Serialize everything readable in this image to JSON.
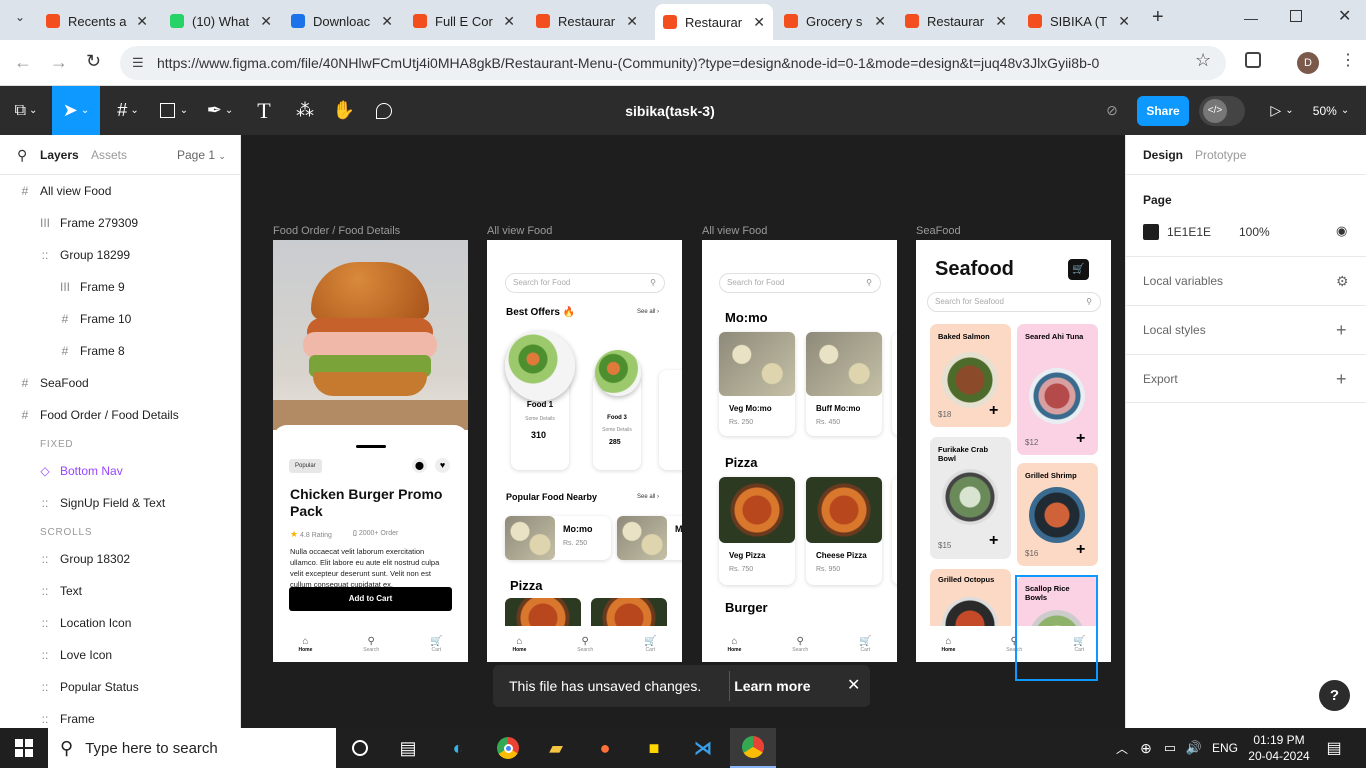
{
  "browser": {
    "tabs": [
      {
        "title": "Recents a",
        "color": "#f24e1e"
      },
      {
        "title": "(10) What",
        "color": "#25d366"
      },
      {
        "title": "Downloac",
        "color": "#1a73e8"
      },
      {
        "title": "Full E Cor",
        "color": "#f24e1e"
      },
      {
        "title": "Restaurar",
        "color": "#f24e1e"
      },
      {
        "title": "Restaurar",
        "color": "#f24e1e"
      },
      {
        "title": "Grocery s",
        "color": "#f24e1e"
      },
      {
        "title": "Restaurar",
        "color": "#f24e1e"
      },
      {
        "title": "SIBIKA (T",
        "color": "#f24e1e"
      }
    ],
    "active_tab": 5,
    "close_glyph": "✕",
    "new_tab_glyph": "+",
    "url": "https://www.figma.com/file/40NHlwFCmUtj4i0MHA8gkB/Restaurant-Menu-(Community)?type=design&node-id=0-1&mode=design&t=juq48v3JlxGyii8b-0",
    "profile_initial": "D"
  },
  "figma": {
    "file_title": "sibika(task-3)",
    "share_label": "Share",
    "zoom": "50%",
    "layers_tab": "Layers",
    "assets_tab": "Assets",
    "page_selector": "Page 1",
    "layers": [
      {
        "name": "All view Food",
        "indent": 0,
        "icon": "#"
      },
      {
        "name": "Frame 279309",
        "indent": 1,
        "icon": "III"
      },
      {
        "name": "Group 18299",
        "indent": 1,
        "icon": "::"
      },
      {
        "name": "Frame 9",
        "indent": 2,
        "icon": "III"
      },
      {
        "name": "Frame 10",
        "indent": 2,
        "icon": "#"
      },
      {
        "name": "Frame 8",
        "indent": 2,
        "icon": "#"
      },
      {
        "name": "SeaFood",
        "indent": 0,
        "icon": "#"
      },
      {
        "name": "Food Order / Food Details",
        "indent": 0,
        "icon": "#"
      }
    ],
    "section_fixed": "FIXED",
    "fixed_layers": [
      {
        "name": "Bottom Nav",
        "icon": "◇",
        "component": true
      },
      {
        "name": "SignUp Field & Text",
        "icon": "::",
        "component": false
      }
    ],
    "section_scrolls": "SCROLLS",
    "scroll_layers": [
      "Group 18302",
      "Text",
      "Location Icon",
      "Love Icon",
      "Popular Status",
      "Frame"
    ],
    "design_tab": "Design",
    "prototype_tab": "Prototype",
    "page_heading": "Page",
    "page_color": "1E1E1E",
    "page_opacity": "100%",
    "local_variables": "Local variables",
    "local_styles": "Local styles",
    "export": "Export",
    "toast_text": "This file has unsaved changes.",
    "toast_link": "Learn more",
    "help": "?"
  },
  "frames": {
    "f1": {
      "label": "Food Order / Food Details",
      "badge": "Popular",
      "title": "Chicken Burger Promo Pack",
      "rating": "4.8 Rating",
      "orders": "2000+ Order",
      "desc": "Nulla occaecat velit laborum exercitation ullamco. Elit labore eu aute elit nostrud culpa velit excepteur deserunt sunt. Velit non est cullum consequat cupidatat ex.",
      "cta": "Add to Cart"
    },
    "f2": {
      "label": "All view Food",
      "search": "Search for Food",
      "best_offers": "Best Offers",
      "see_all": "See all",
      "food1": "Food 1",
      "food1_details": "Some Details",
      "food1_price": "310",
      "food3": "Food 3",
      "food3_details": "Some Details",
      "food3_price": "285",
      "popular": "Popular Food Nearby",
      "momo": "Mo:mo",
      "momo_price": "Rs. 250",
      "pizza": "Pizza"
    },
    "f3": {
      "label": "All view Food",
      "search": "Search for Food",
      "momo": "Mo:mo",
      "veg_momo": "Veg Mo:mo",
      "veg_momo_price": "Rs. 250",
      "buff_momo": "Buff Mo:mo",
      "buff_momo_price": "Rs. 450",
      "pizza": "Pizza",
      "veg_pizza": "Veg Pizza",
      "veg_pizza_price": "Rs. 750",
      "cheese_pizza": "Cheese Pizza",
      "cheese_pizza_price": "Rs. 950",
      "burger": "Burger"
    },
    "f4": {
      "label": "SeaFood",
      "title": "Seafood",
      "search": "Search for Seafood",
      "items": [
        {
          "name": "Baked Salmon",
          "price": "$18"
        },
        {
          "name": "Seared Ahi Tuna",
          "price": "$12"
        },
        {
          "name": "Furikake Crab Bowl",
          "price": "$15"
        },
        {
          "name": "Grilled Shrimp",
          "price": "$16"
        },
        {
          "name": "Grilled Octopus",
          "price": ""
        },
        {
          "name": "Scallop Rice Bowls",
          "price": ""
        }
      ]
    },
    "nav": {
      "home": "Home",
      "search": "Search",
      "cart": "Cart"
    }
  },
  "taskbar": {
    "search_placeholder": "Type here to search",
    "lang": "ENG",
    "time": "01:19 PM",
    "date": "20-04-2024"
  }
}
